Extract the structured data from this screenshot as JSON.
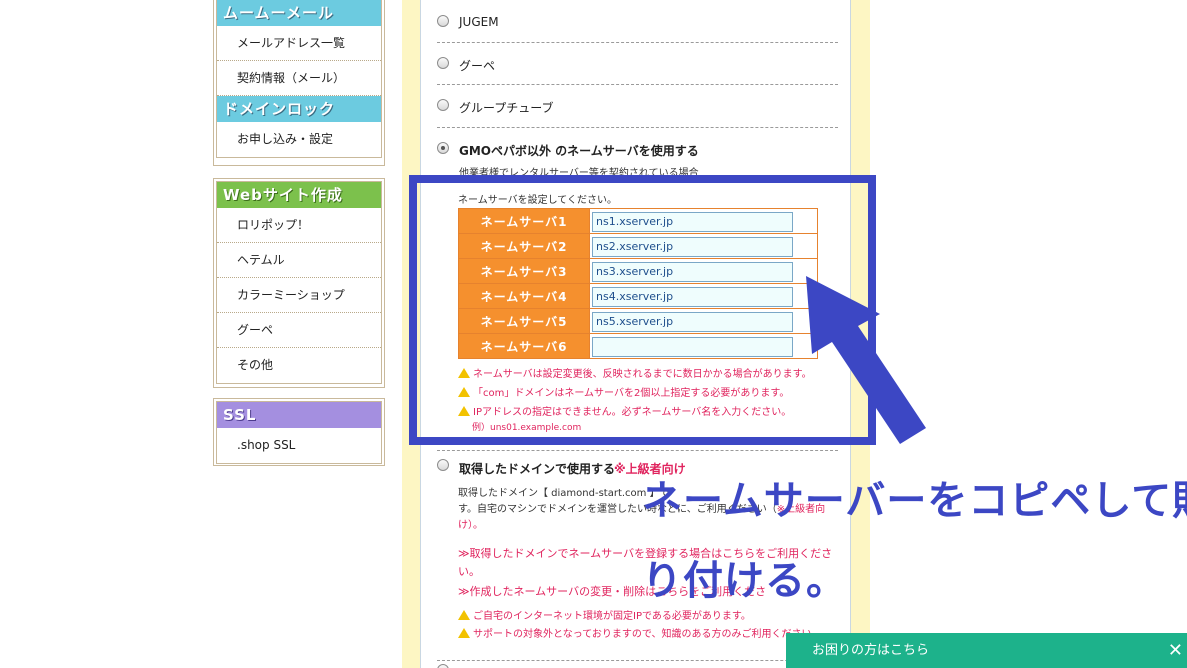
{
  "sidebar": {
    "mail": {
      "heading": "ムームーメール",
      "items": [
        "メールアドレス一覧",
        "契約情報（メール）"
      ]
    },
    "domain_lock": {
      "heading": "ドメインロック",
      "items": [
        "お申し込み・設定"
      ]
    },
    "website": {
      "heading": "Webサイト作成",
      "items": [
        "ロリポップ！",
        "ヘテムル",
        "カラーミーショップ",
        "グーペ",
        "その他"
      ]
    },
    "ssl": {
      "heading": "SSL",
      "items": [
        ".shop SSL"
      ]
    }
  },
  "options": {
    "jugem": "JUGEM",
    "goope": "グーペ",
    "grouptube": "グループチューブ",
    "other_ns": "GMOペパボ以外 のネームサーバを使用する",
    "other_ns_note": "他業者様でレンタルサーバー等を契約されている場合",
    "own_domain": "取得したドメインで使用する",
    "own_domain_tag": "※上級者向け"
  },
  "nameserver": {
    "intro": "ネームサーバを設定してください。",
    "rows": [
      {
        "label": "ネームサーバ1",
        "value": "ns1.xserver.jp"
      },
      {
        "label": "ネームサーバ2",
        "value": "ns2.xserver.jp"
      },
      {
        "label": "ネームサーバ3",
        "value": "ns3.xserver.jp"
      },
      {
        "label": "ネームサーバ4",
        "value": "ns4.xserver.jp"
      },
      {
        "label": "ネームサーバ5",
        "value": "ns5.xserver.jp"
      },
      {
        "label": "ネームサーバ6",
        "value": ""
      }
    ],
    "warnings": [
      "ネームサーバは設定変更後、反映されるまでに数日かかる場合があります。",
      "「com」ドメインはネームサーバを2個以上指定する必要があります。",
      "IPアドレスの指定はできません。必ずネームサーバ名を入力ください。"
    ],
    "example": "例）uns01.example.com"
  },
  "own_domain_section": {
    "desc_line1": "取得したドメイン【 diamond-start.com 】で",
    "desc_line2": "す。自宅のマシンでドメインを運営したい時など",
    "desc_line3": "け）。",
    "desc_tail": "に、ご利用ください（",
    "desc_advanced": "※上級者向",
    "link1_line1": "≫取得したドメインでネームサーバを登録する場合はこちらをご利用くださ",
    "link1_line2": "い。",
    "link2": "≫作成したネームサーバの変更・削除はこちらをご利用くださ",
    "warn1": "ご自宅のインターネット環境が固定IPである必要があります。",
    "warn2": "サポートの対象外となっておりますので、知識のある方のみご利用ください。"
  },
  "annotation": {
    "line1": "ネームサーバーをコピペして貼",
    "line2": "り付ける。"
  },
  "help_bar": {
    "label": "お困りの方はこちら",
    "close": "✕"
  },
  "colors": {
    "annotation_blue": "#3c47c4",
    "help_green": "#1db28b",
    "ns_label_orange": "#f5902e"
  }
}
